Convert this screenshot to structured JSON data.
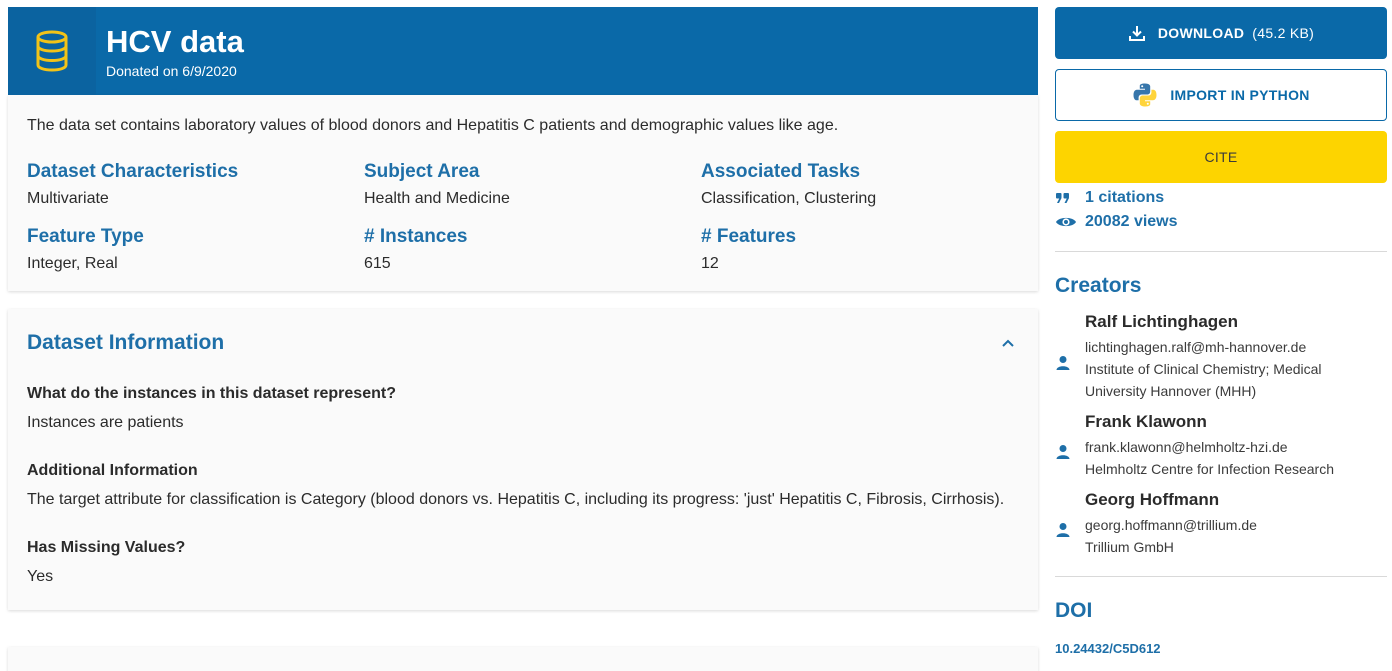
{
  "header": {
    "title": "HCV data",
    "donated": "Donated on 6/9/2020",
    "icon": "database-icon"
  },
  "summary": {
    "description": "The data set contains laboratory values of blood donors and Hepatitis C patients and demographic values like age.",
    "characteristics": [
      {
        "label": "Dataset Characteristics",
        "value": "Multivariate"
      },
      {
        "label": "Subject Area",
        "value": "Health and Medicine"
      },
      {
        "label": "Associated Tasks",
        "value": "Classification, Clustering"
      },
      {
        "label": "Feature Type",
        "value": "Integer, Real"
      },
      {
        "label": "# Instances",
        "value": "615"
      },
      {
        "label": "# Features",
        "value": "12"
      }
    ]
  },
  "info": {
    "title": "Dataset Information",
    "sections": [
      {
        "question": "What do the instances in this dataset represent?",
        "answer": "Instances are patients"
      },
      {
        "question": "Additional Information",
        "answer": "The target attribute for classification is Category (blood donors vs. Hepatitis C, including its progress: 'just' Hepatitis C, Fibrosis, Cirrhosis)."
      },
      {
        "question": "Has Missing Values?",
        "answer": "Yes"
      }
    ]
  },
  "actions": {
    "download_label": "DOWNLOAD",
    "download_size": "(45.2 KB)",
    "python_label": "IMPORT IN PYTHON",
    "cite_label": "CITE"
  },
  "stats": {
    "citations": "1 citations",
    "views": "20082 views"
  },
  "creators": {
    "title": "Creators",
    "people": [
      {
        "name": "Ralf Lichtinghagen",
        "email": "lichtinghagen.ralf@mh-hannover.de",
        "affiliation_1": "Institute of Clinical Chemistry; Medical",
        "affiliation_2": "University Hannover (MHH)"
      },
      {
        "name": "Frank Klawonn",
        "email": "frank.klawonn@helmholtz-hzi.de",
        "affiliation_1": "Helmholtz Centre for Infection Research",
        "affiliation_2": ""
      },
      {
        "name": "Georg Hoffmann",
        "email": "georg.hoffmann@trillium.de",
        "affiliation_1": "Trillium GmbH",
        "affiliation_2": ""
      }
    ]
  },
  "doi": {
    "title": "DOI",
    "value": "10.24432/C5D612"
  },
  "colors": {
    "primary": "#0a69a8",
    "accent_text": "#1e6fa8",
    "cite": "#fdd400",
    "db_icon": "#f2c318"
  }
}
